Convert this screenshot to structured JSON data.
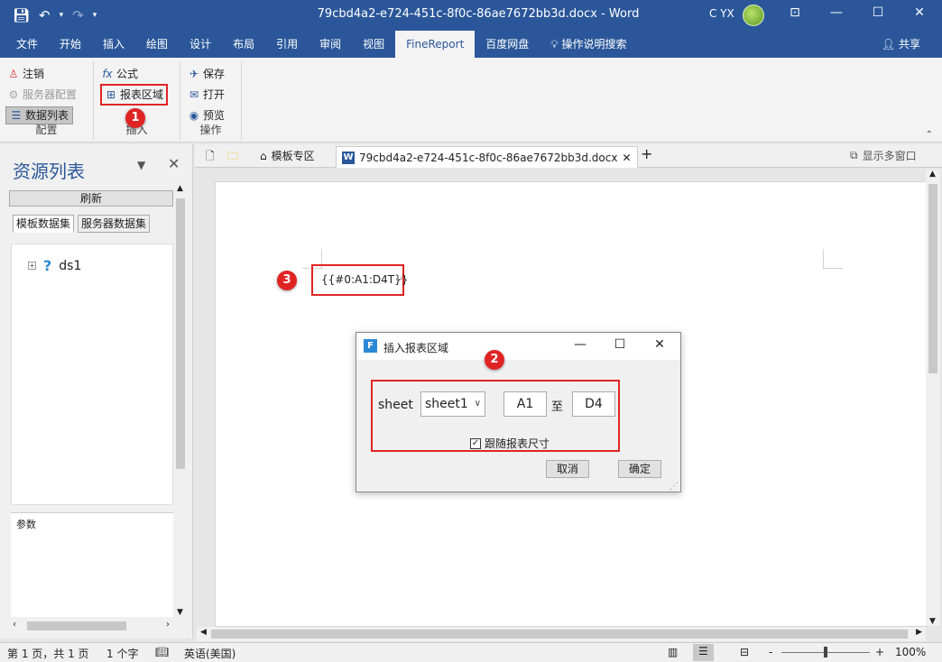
{
  "window": {
    "title": "79cbd4a2-e724-451c-8f0c-86ae7672bb3d.docx - Word",
    "user": "C YX",
    "icons": [
      "save-icon",
      "undo-icon",
      "redo-icon",
      "customize-qat-icon",
      "ribbon-display-icon",
      "minimize-icon",
      "maximize-icon",
      "close-icon"
    ]
  },
  "ribbon_tabs": [
    "文件",
    "开始",
    "插入",
    "绘图",
    "设计",
    "布局",
    "引用",
    "审阅",
    "视图",
    "FineReport",
    "百度网盘",
    "操作说明搜索"
  ],
  "active_tab": "FineReport",
  "share_label": "共享",
  "groups": {
    "config": {
      "name": "配置",
      "logout": "注销",
      "server_config": "服务器配置",
      "data_list": "数据列表"
    },
    "insert": {
      "name": "插入",
      "formula": "公式",
      "report_area": "报表区域"
    },
    "operation": {
      "name": "操作",
      "save": "保存",
      "open": "打开",
      "preview": "预览"
    }
  },
  "left_pane": {
    "title": "资源列表",
    "refresh": "刷新",
    "tabs": [
      "模板数据集",
      "服务器数据集"
    ],
    "tree": [
      {
        "label": "ds1"
      }
    ],
    "params_label": "参数"
  },
  "doc_tabs": {
    "template_zone": "模板专区",
    "active_doc": "79cbd4a2-e724-451c-8f0c-86ae7672bb3d.docx",
    "add": "+",
    "multi_window": "显示多窗口"
  },
  "document": {
    "field_text": "{{#0:A1:D4T}}"
  },
  "dialog": {
    "title": "插入报表区域",
    "sheet_label": "sheet",
    "sheet_value": "sheet1",
    "from_cell": "A1",
    "to_label": "至",
    "to_cell": "D4",
    "follow_size_label": "跟随报表尺寸",
    "follow_size_checked": true,
    "cancel": "取消",
    "ok": "确定"
  },
  "badges": [
    "1",
    "2",
    "3"
  ],
  "status_bar": {
    "page": "第 1 页，共 1 页",
    "words": "1 个字",
    "language": "英语(美国)",
    "zoom": "100%",
    "zoom_minus": "-",
    "zoom_plus": "+"
  },
  "colors": {
    "word_blue": "#2b579a",
    "highlight_red": "#e02424"
  }
}
